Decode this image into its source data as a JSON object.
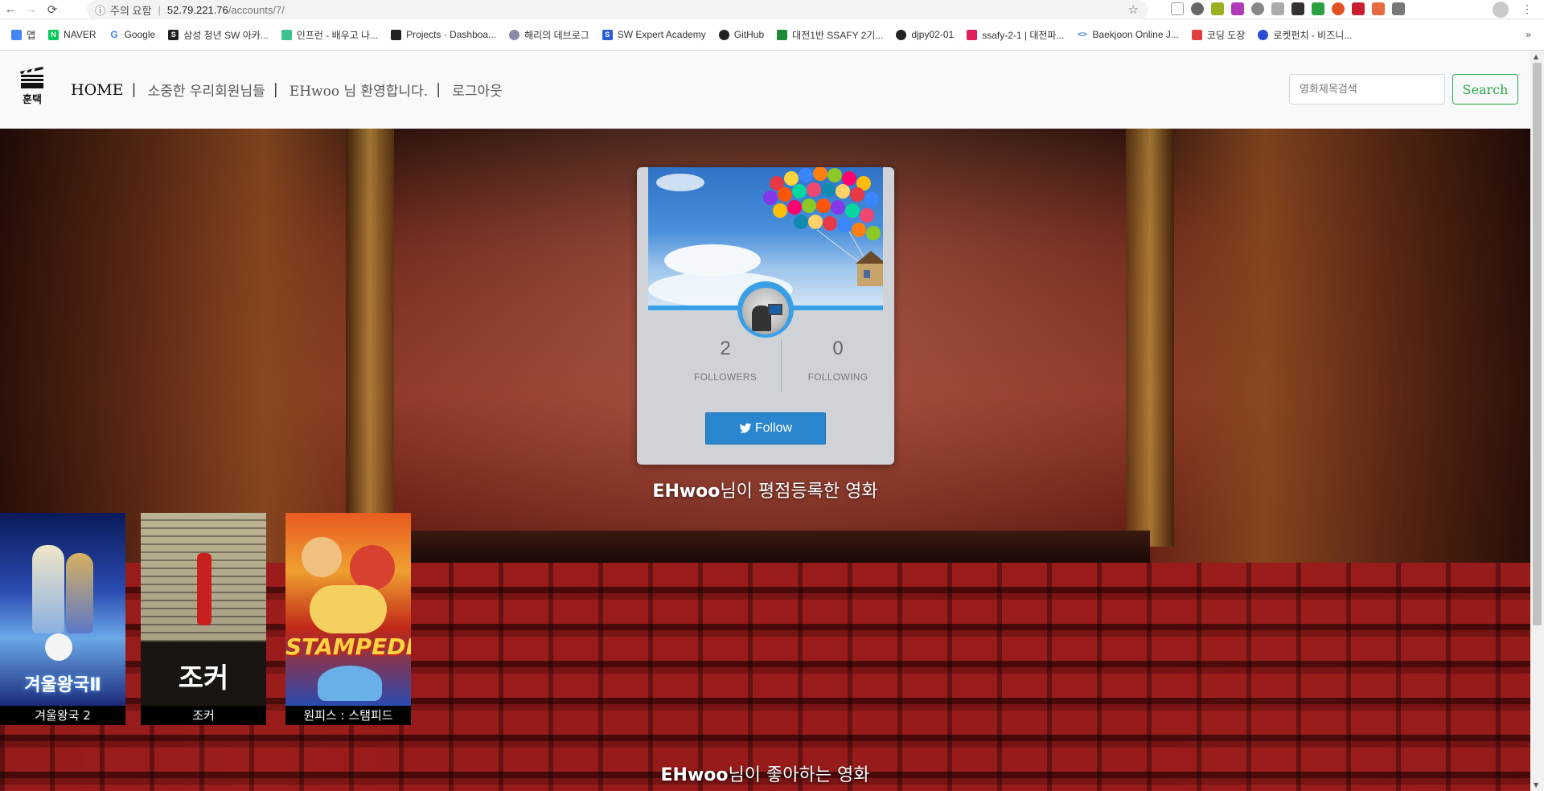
{
  "browser": {
    "security_label": "주의 요함",
    "url_host": "52.79.221.76",
    "url_path": "/accounts/7/",
    "bookmarks": [
      {
        "label": "앱",
        "color": "#4285f4"
      },
      {
        "label": "NAVER",
        "color": "#03c75a"
      },
      {
        "label": "Google",
        "color": "#ea4335"
      },
      {
        "label": "삼성 청년 SW 아카...",
        "color": "#222222"
      },
      {
        "label": "인프런 - 배우고 나...",
        "color": "#3ec28f"
      },
      {
        "label": "Projects · Dashboa...",
        "color": "#222222"
      },
      {
        "label": "해리의 데브로그",
        "color": "#8a8aa8"
      },
      {
        "label": "SW Expert Academy",
        "color": "#2a5bd7"
      },
      {
        "label": "GitHub",
        "color": "#222222"
      },
      {
        "label": "대전1반 SSAFY 2기...",
        "color": "#1a8a3a"
      },
      {
        "label": "djpy02-01",
        "color": "#222222"
      },
      {
        "label": "ssafy-2-1 | 대전파...",
        "color": "#e01e5a"
      },
      {
        "label": "Baekjoon Online J...",
        "color": "#3a7bd5"
      },
      {
        "label": "코딩 도장",
        "color": "#e04040"
      },
      {
        "label": "로켓펀치 - 비즈니...",
        "color": "#2a4ad5"
      }
    ]
  },
  "nav": {
    "logo_text": "훈택",
    "home": "HOME",
    "members": "소중한 우리회원님들",
    "welcome": "EHwoo 님 환영합니다.",
    "logout": "로그아웃",
    "sep": "|",
    "search_placeholder": "영화제목검색",
    "search_button": "Search"
  },
  "profile": {
    "followers_count": "2",
    "followers_label": "FOLLOWERS",
    "following_count": "0",
    "following_label": "FOLLOWING",
    "follow_button": "Follow"
  },
  "sections": {
    "registered_user": "EHwoo",
    "registered_suffix": "님이 평점등록한 영화",
    "liked_user": "EHwoo",
    "liked_suffix": "님이 좋아하는 영화"
  },
  "movies": [
    {
      "title": "겨울왕국 2"
    },
    {
      "title": "조커"
    },
    {
      "title": "원피스 : 스탬피드"
    }
  ],
  "colors": {
    "search_button": "#28a745",
    "follow_button": "#2a86cf",
    "card_bg": "#cfd3d8"
  }
}
